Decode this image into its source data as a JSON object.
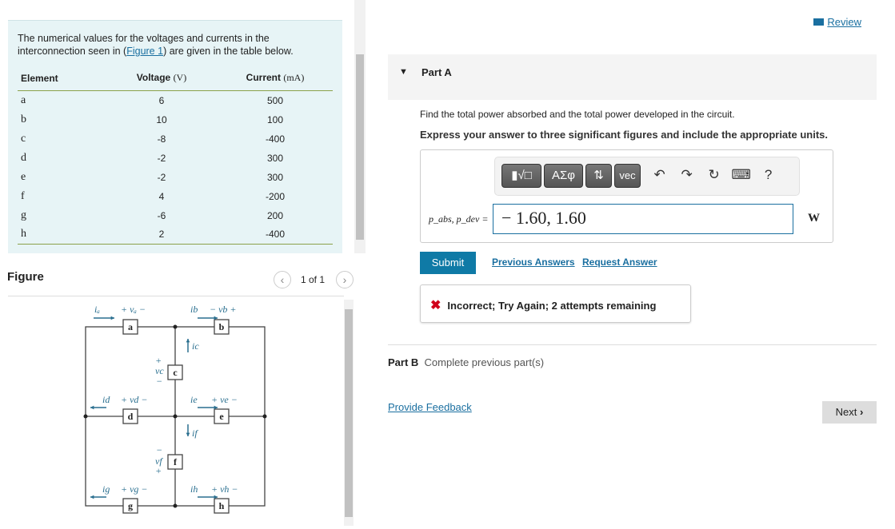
{
  "left": {
    "intro_text": "The numerical values for the voltages and currents in the interconnection seen in (",
    "intro_link": "Figure 1",
    "intro_end": ") are given in the table below.",
    "table": {
      "headers": [
        "Element",
        "Voltage",
        "(V)",
        "Current",
        "(mA)"
      ],
      "rows": [
        [
          "a",
          "6",
          "500"
        ],
        [
          "b",
          "10",
          "100"
        ],
        [
          "c",
          "-8",
          "-400"
        ],
        [
          "d",
          "-2",
          "300"
        ],
        [
          "e",
          "-2",
          "300"
        ],
        [
          "f",
          "4",
          "-200"
        ],
        [
          "g",
          "-6",
          "200"
        ],
        [
          "h",
          "2",
          "-400"
        ]
      ]
    },
    "figure_title": "Figure",
    "pager": "1 of 1",
    "circuit": {
      "elements": [
        "a",
        "b",
        "c",
        "d",
        "e",
        "f",
        "g",
        "h"
      ]
    }
  },
  "right": {
    "review": "Review",
    "partA_title": "Part A",
    "question": "Find the total power absorbed and the total power developed in the circuit.",
    "instruction": "Express your answer to three significant figures and include the appropriate units.",
    "toolbar": {
      "templates": "▮√□",
      "greek": "ΑΣφ",
      "arrows": "⇅",
      "vec": "vec",
      "help": "?"
    },
    "answer_label": "p_abs, p_dev =",
    "answer_value": "− 1.60, 1.60",
    "unit": "W",
    "submit": "Submit",
    "prev_answers": "Previous Answers",
    "request_answer": "Request Answer",
    "feedback": "Incorrect; Try Again; 2 attempts remaining",
    "partB_label": "Part B",
    "partB_text": "Complete previous part(s)",
    "provide_feedback": "Provide Feedback",
    "next": "Next"
  },
  "colors": {
    "accent": "#1a6fa0",
    "error": "#d0021b",
    "submit": "#0f7aa6",
    "table_bg": "#e7f4f6"
  }
}
